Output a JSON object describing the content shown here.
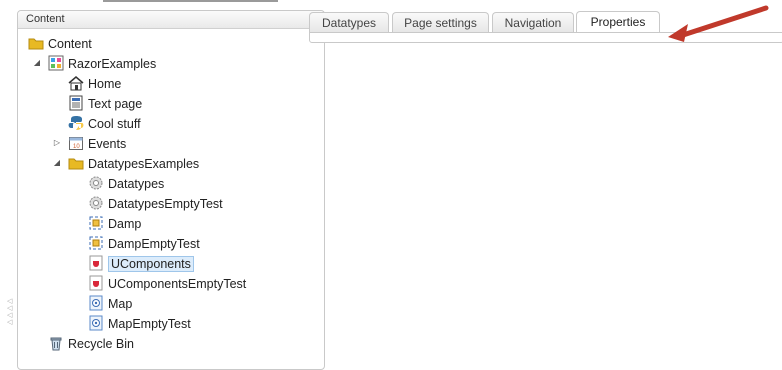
{
  "content_panel": {
    "title": "Content",
    "tree": [
      {
        "label": "Content",
        "icon": "folder-icon",
        "expander": ""
      },
      {
        "label": "RazorExamples",
        "icon": "site-icon",
        "expander": "expanded"
      },
      {
        "label": "Home",
        "icon": "home-icon",
        "expander": ""
      },
      {
        "label": "Text page",
        "icon": "text-page-icon",
        "expander": ""
      },
      {
        "label": "Cool stuff",
        "icon": "python-icon",
        "expander": ""
      },
      {
        "label": "Events",
        "icon": "calendar-icon",
        "expander": "collapsed"
      },
      {
        "label": "DatatypesExamples",
        "icon": "folder-icon",
        "expander": "expanded"
      },
      {
        "label": "Datatypes",
        "icon": "gear-icon",
        "expander": ""
      },
      {
        "label": "DatatypesEmptyTest",
        "icon": "gear-icon",
        "expander": ""
      },
      {
        "label": "Damp",
        "icon": "damp-icon",
        "expander": ""
      },
      {
        "label": "DampEmptyTest",
        "icon": "damp-icon",
        "expander": ""
      },
      {
        "label": "UComponents",
        "icon": "ucomponents-icon",
        "expander": "",
        "selected": true
      },
      {
        "label": "UComponentsEmptyTest",
        "icon": "ucomponents-icon",
        "expander": ""
      },
      {
        "label": "Map",
        "icon": "map-icon",
        "expander": ""
      },
      {
        "label": "MapEmptyTest",
        "icon": "map-icon",
        "expander": ""
      },
      {
        "label": "Recycle Bin",
        "icon": "recycle-bin-icon",
        "expander": ""
      }
    ]
  },
  "tabs": [
    {
      "label": "Datatypes",
      "active": false
    },
    {
      "label": "Page settings",
      "active": false
    },
    {
      "label": "Navigation",
      "active": false
    },
    {
      "label": "Properties",
      "active": true
    }
  ],
  "annotation": {
    "icon": "red-arrow-icon",
    "color": "#c0392b"
  }
}
